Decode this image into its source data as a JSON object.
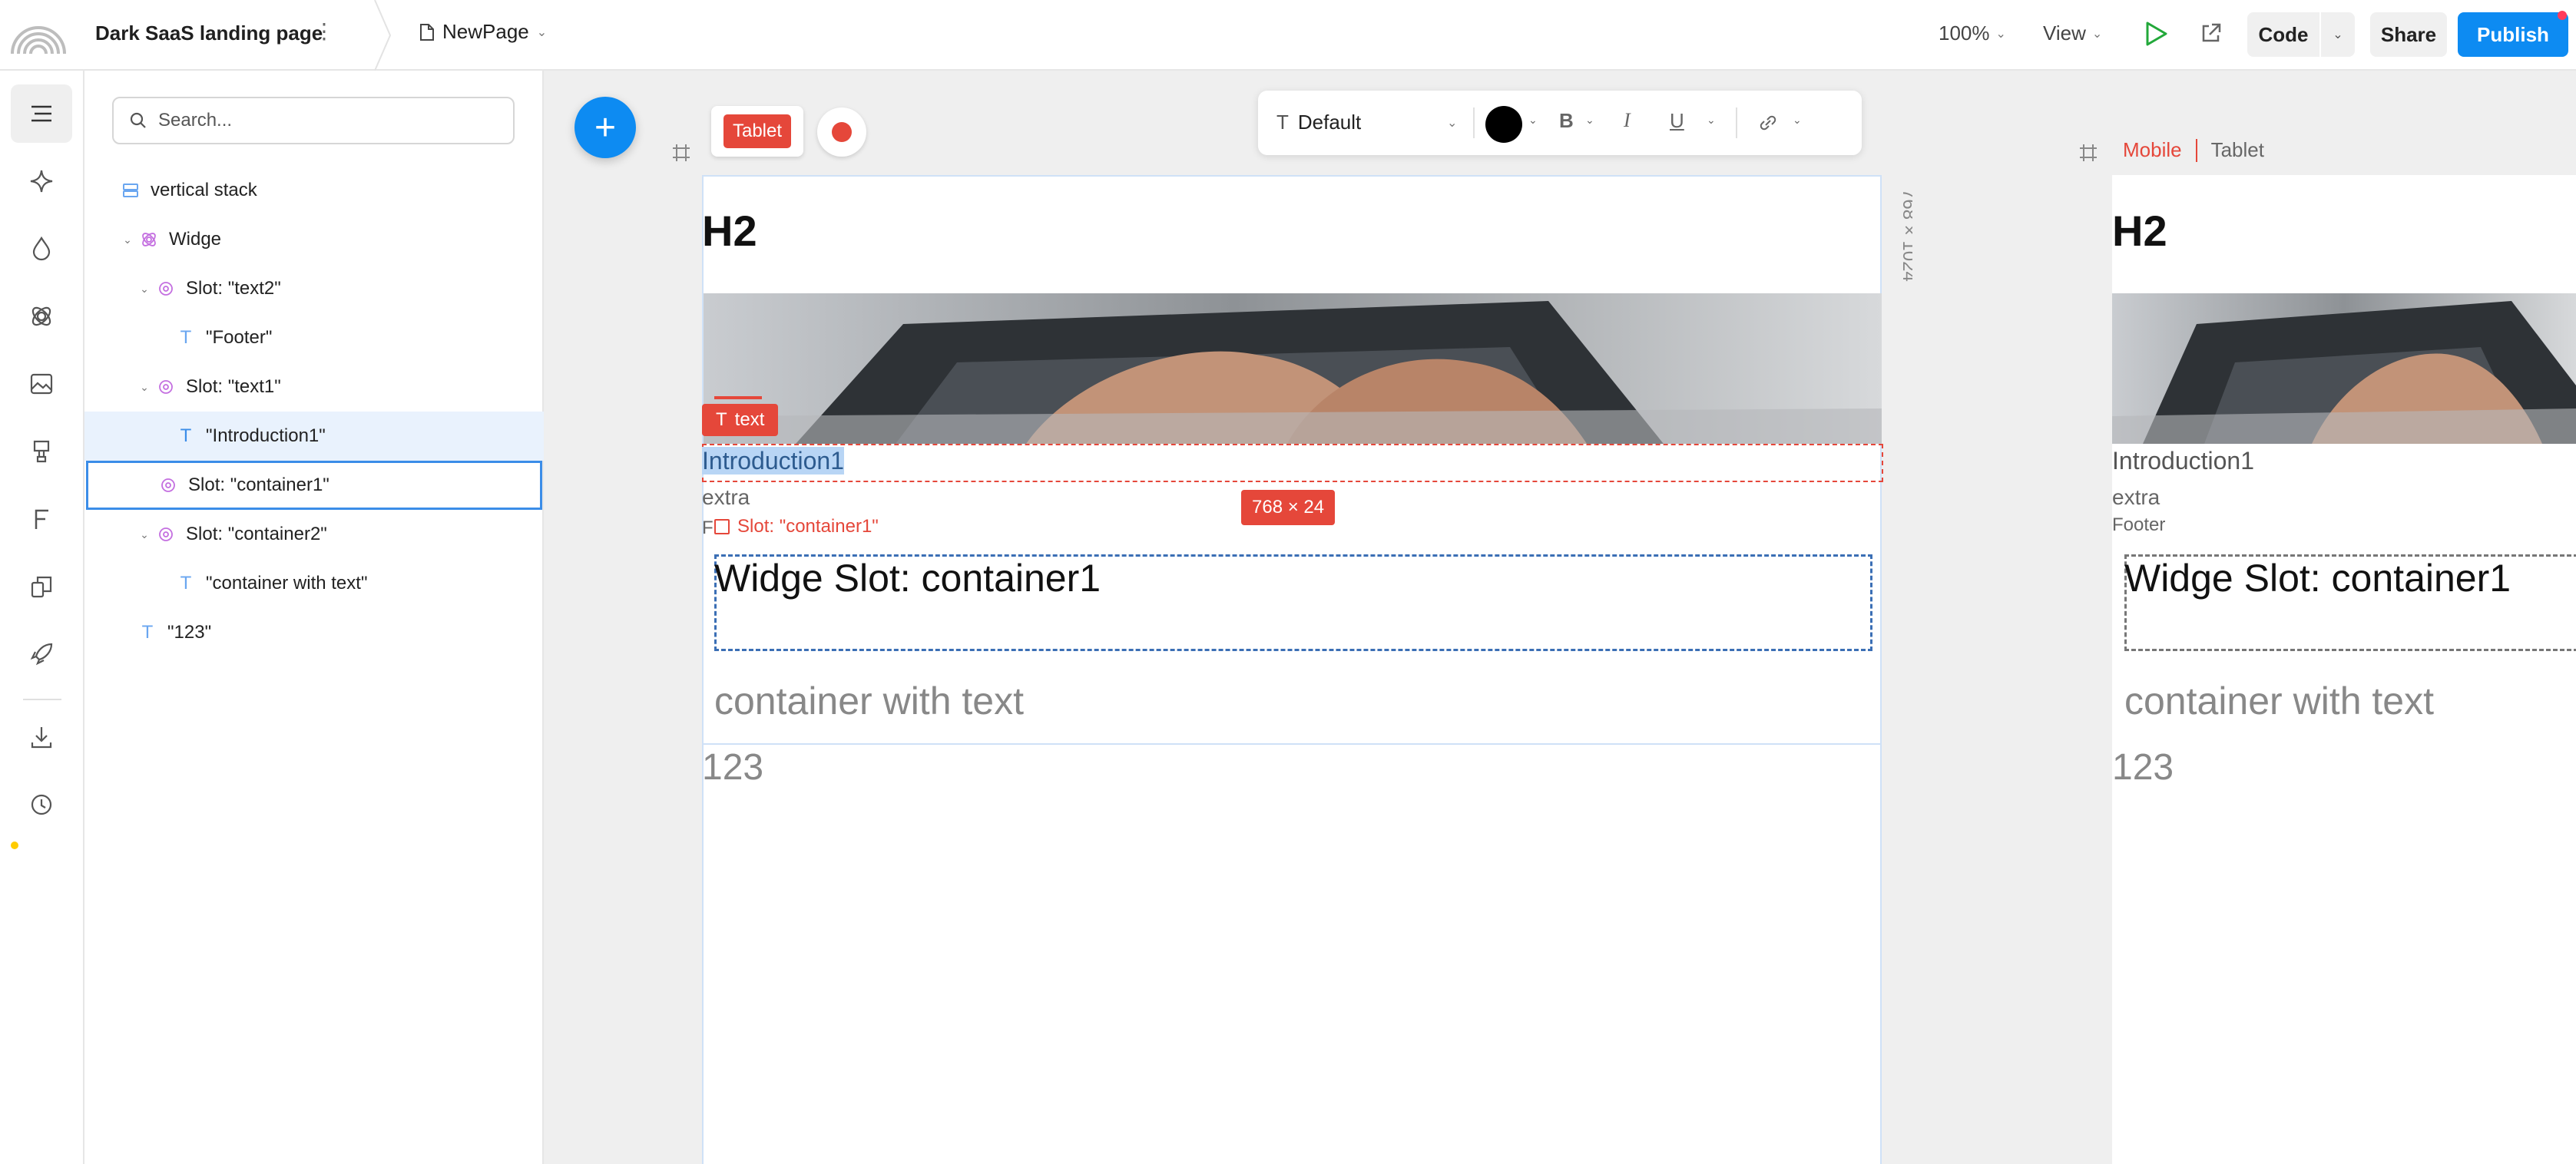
{
  "topbar": {
    "project_title": "Dark SaaS landing page",
    "page_name": "NewPage",
    "zoom": "100%",
    "view_label": "View",
    "code_label": "Code",
    "share_label": "Share",
    "publish_label": "Publish"
  },
  "layers": {
    "search_placeholder": "Search...",
    "items": [
      {
        "label": "vertical stack"
      },
      {
        "label": "Widge"
      },
      {
        "label": "Slot: \"text2\""
      },
      {
        "label": "\"Footer\""
      },
      {
        "label": "Slot: \"text1\""
      },
      {
        "label": "\"Introduction1\""
      },
      {
        "label": "Slot: \"container1\""
      },
      {
        "label": "Slot: \"container2\""
      },
      {
        "label": "\"container with text\""
      },
      {
        "label": "\"123\""
      }
    ]
  },
  "canvas": {
    "tablet_label": "Tablet",
    "dimensions": "768 × 1024",
    "format_style": "Default",
    "text_tag": "text",
    "size_badge": "768  ×  24",
    "slot_hint": "Slot: \"container1\"",
    "frame_tabs": {
      "mobile": "Mobile",
      "tablet": "Tablet"
    }
  },
  "tablet": {
    "h2": "H2",
    "intro": "Introduction1",
    "extra": "extra",
    "footer_initial": "F",
    "widge_title": "Widge Slot: container1",
    "container_text": "container with text",
    "number": "123"
  },
  "mobile": {
    "h2": "H2",
    "intro": "Introduction1",
    "extra": "extra",
    "footer": "Footer",
    "widge_title": "Widge Slot: container1",
    "container_text": "container with text",
    "number": "123"
  },
  "colors": {
    "accent": "#0d8bf2",
    "selection_red": "#e5473a",
    "selection_blue": "#3b8de8"
  }
}
